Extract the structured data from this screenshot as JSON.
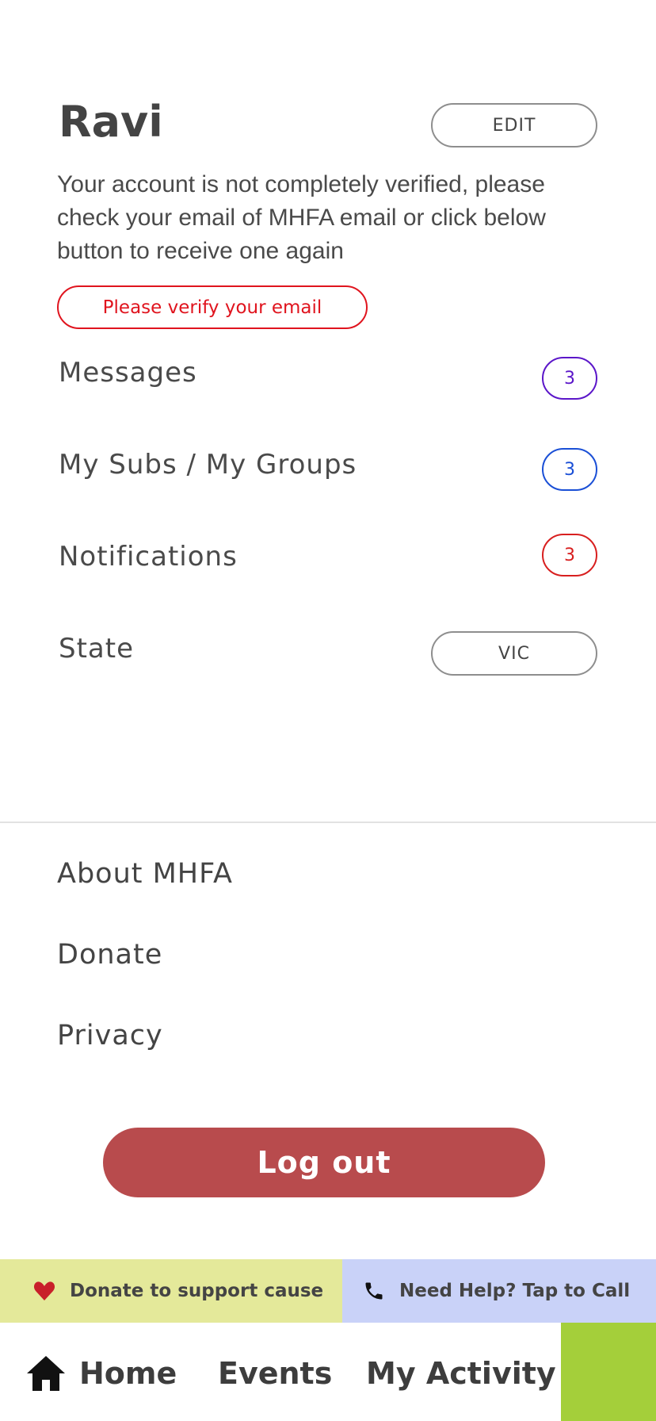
{
  "profile": {
    "name": "Ravi",
    "edit_label": "EDIT",
    "notice": "Your account is not completely verified, please check your email of MHFA email or click below button to receive one again",
    "verify_label": "Please verify your email"
  },
  "rows": {
    "messages": {
      "label": "Messages",
      "count": "3",
      "color": "#5b16c9"
    },
    "subs": {
      "label": "My Subs / My Groups",
      "count": "3",
      "color": "#1a4fd6"
    },
    "notifications": {
      "label": "Notifications",
      "count": "3",
      "color": "#d81f1f"
    },
    "state": {
      "label": "State",
      "value": "VIC"
    }
  },
  "links": {
    "about": "About MHFA",
    "donate": "Donate",
    "privacy": "Privacy"
  },
  "logout_label": "Log out",
  "banners": {
    "donate": "Donate to support cause",
    "help": "Need Help? Tap to Call"
  },
  "nav": {
    "home": "Home",
    "events": "Events",
    "activity": "My Activity"
  },
  "icons": {
    "donate": "heart-icon",
    "help": "phone-icon",
    "home": "home-icon"
  }
}
